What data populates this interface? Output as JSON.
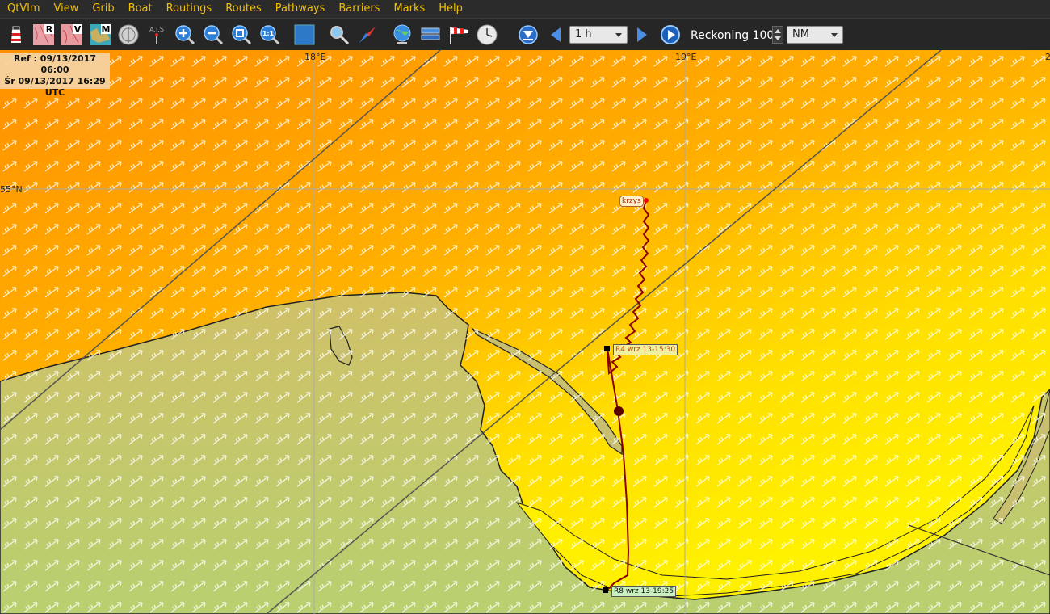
{
  "menu": [
    "QtVlm",
    "View",
    "Grib",
    "Boat",
    "Routings",
    "Routes",
    "Pathways",
    "Barriers",
    "Marks",
    "Help"
  ],
  "toolbar": {
    "icon_r": "R",
    "icon_v": "V",
    "icon_m": "M",
    "ais": "A.I.S",
    "zoom_11": "1:1",
    "step_value": "1 h",
    "reckoning_label": "Reckoning",
    "reckoning_value": "100",
    "unit_value": "NM"
  },
  "info": {
    "ref": "Ref : 09/13/2017 06:00",
    "sr": "Śr 09/13/2017 16:29",
    "tz": "UTC"
  },
  "map": {
    "lon1": "18°E",
    "lon2": "19°E",
    "lon3": "2",
    "lat1": "55°N",
    "boat_name": "krzys",
    "poi_r4": "R4 wrz 13-15:30",
    "poi_r8": "R8 wrz 13-19:25"
  },
  "colors": {
    "menu_text": "#f0c000",
    "track": "#8b0000",
    "land": "#c8c870"
  }
}
